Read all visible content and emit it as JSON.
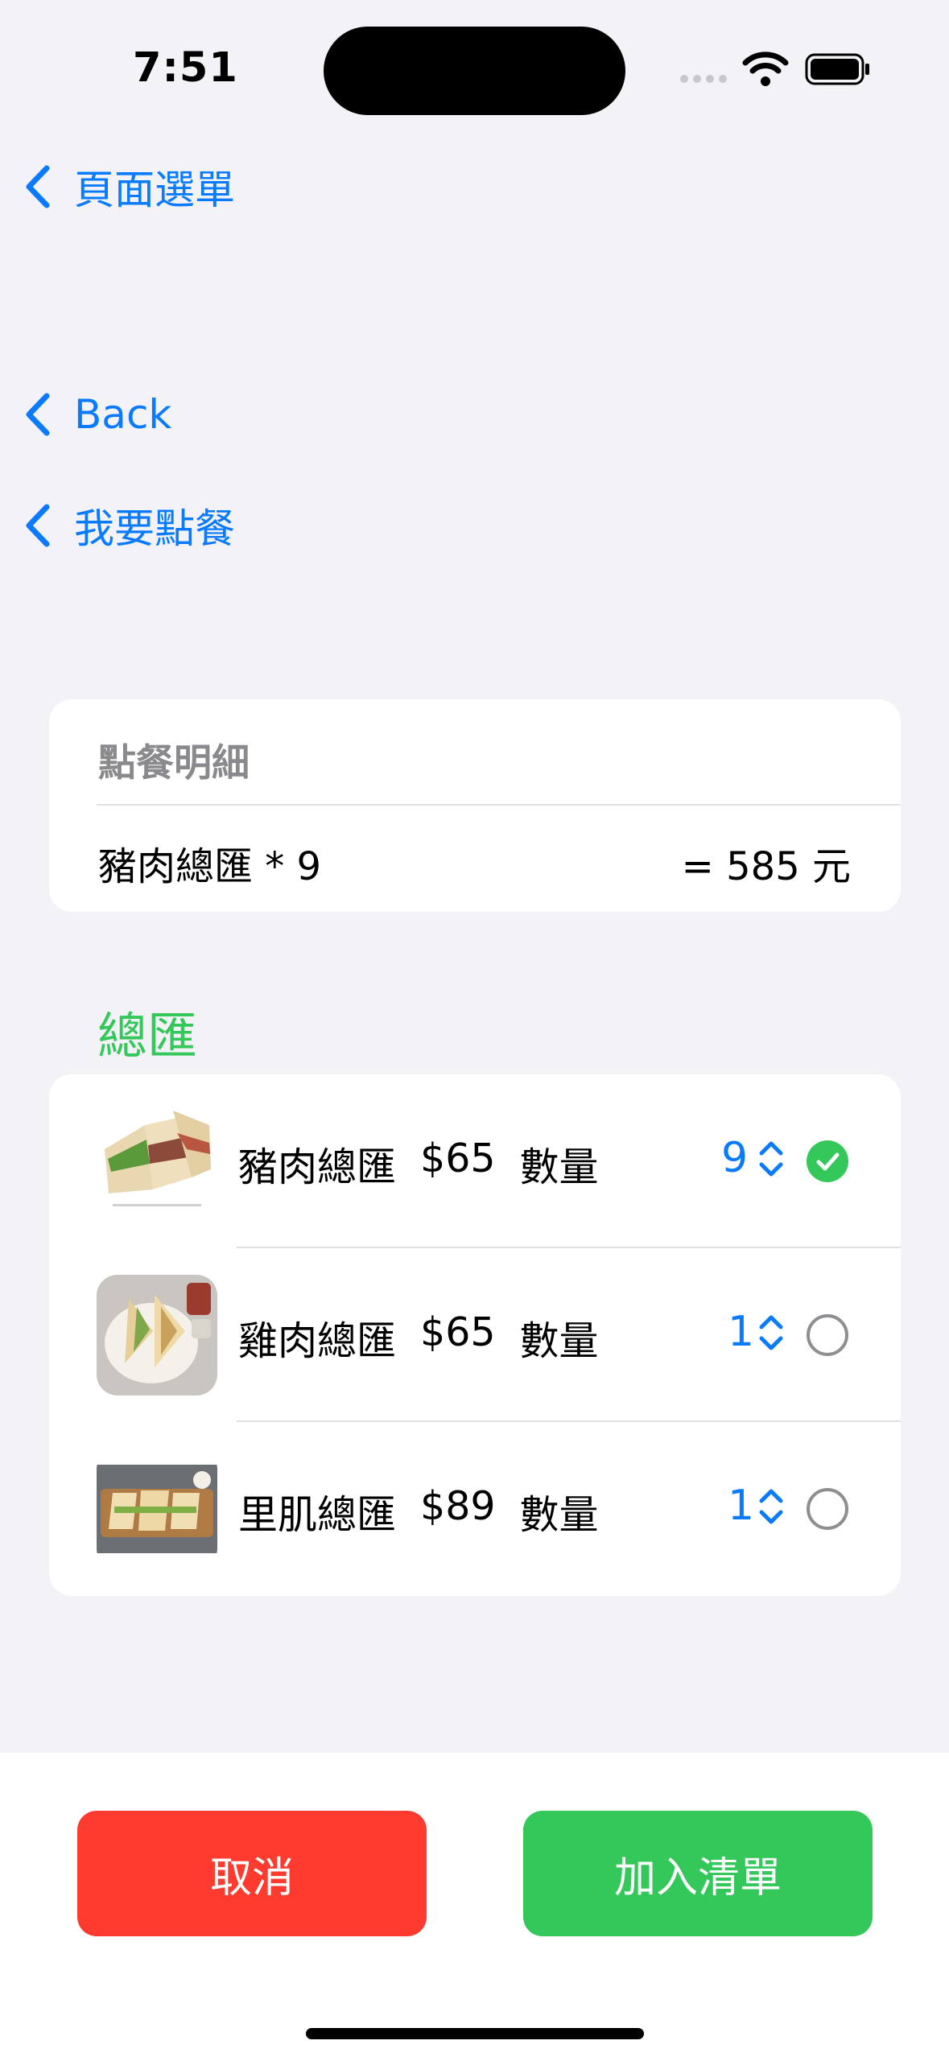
{
  "status_bar": {
    "time": "7:51"
  },
  "nav": {
    "back_links": [
      "頁面選單",
      "Back",
      "我要點餐"
    ]
  },
  "summary": {
    "header": "點餐明細",
    "item": "豬肉總匯 * 9",
    "total": "= 585 元"
  },
  "menu": {
    "section_title": "總匯",
    "items": [
      {
        "name": "豬肉總匯",
        "price": "$65",
        "qty_label": "數量",
        "qty": "9",
        "selected": true
      },
      {
        "name": "雞肉總匯",
        "price": "$65",
        "qty_label": "數量",
        "qty": "1",
        "selected": false
      },
      {
        "name": "里肌總匯",
        "price": "$89",
        "qty_label": "數量",
        "qty": "1",
        "selected": false
      }
    ]
  },
  "actions": {
    "cancel": "取消",
    "add_to_list": "加入清單"
  },
  "colors": {
    "accent_blue": "#0a7aff",
    "green": "#34c759",
    "red": "#ff3b30",
    "background": "#f2f2f7"
  }
}
